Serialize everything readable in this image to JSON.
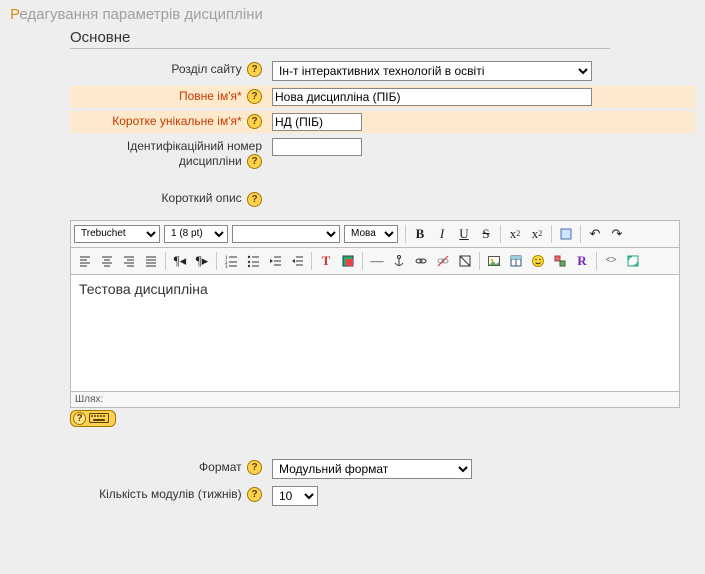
{
  "pageTitle": {
    "first": "Р",
    "rest": "едагування параметрів дисципліни"
  },
  "legend": "Основне",
  "labels": {
    "site": "Розділ сайту",
    "fullname": "Повне ім'я*",
    "shortname": "Коротке унікальне ім'я*",
    "idnumber": "Ідентифікаційний номер дисципліни",
    "summary": "Короткий опис",
    "format": "Формат",
    "numsections": "Кількість модулів (тижнів)"
  },
  "values": {
    "site": "Ін-т інтерактивних технологій в освіті",
    "fullname": "Нова дисципліна (ПІБ)",
    "shortname": "НД (ПІБ)",
    "idnumber": "",
    "format": "Модульний формат",
    "numsections": "10"
  },
  "editor": {
    "font": "Trebuchet",
    "size": "1 (8 pt)",
    "heading": "",
    "lang": "Мова",
    "pathLabel": "Шлях:",
    "content": "Тестова дисципліна"
  },
  "icons": {
    "help": "?"
  }
}
